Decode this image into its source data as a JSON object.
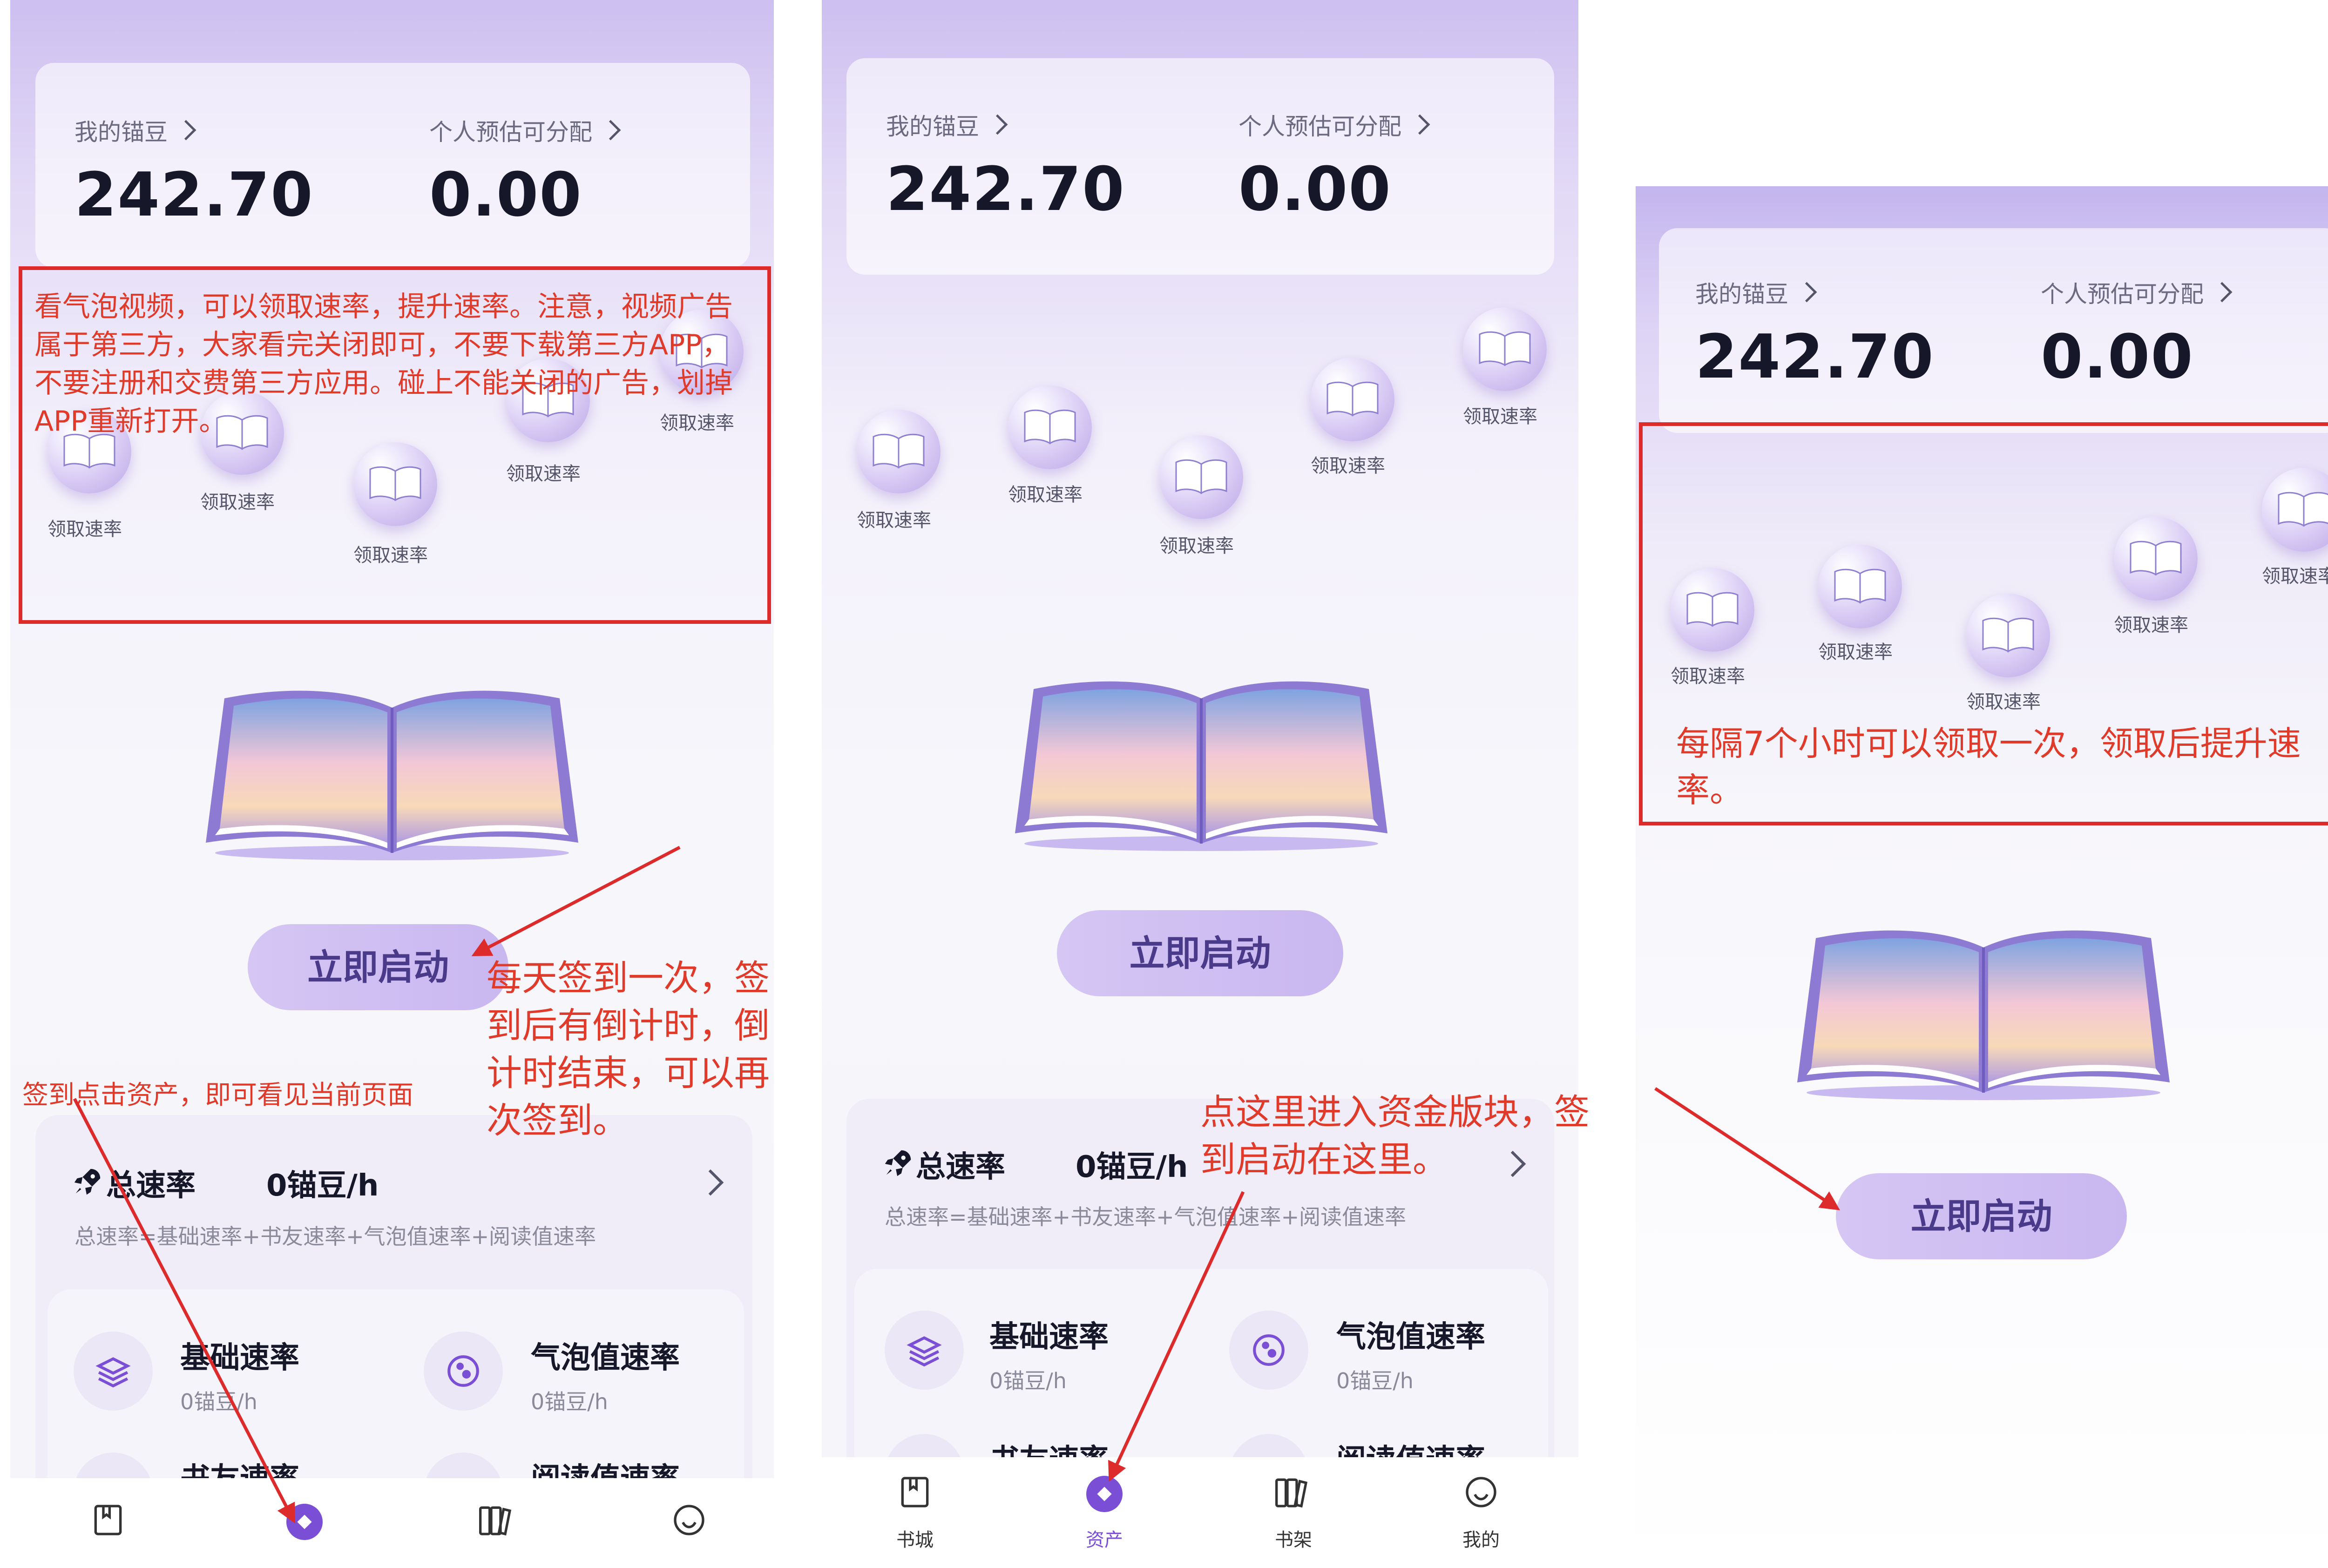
{
  "screens": [
    {
      "cards": {
        "beans_label": "我的锚豆",
        "beans_value": "242.70",
        "share_label": "个人预估可分配",
        "share_value": "0.00"
      },
      "bubble_label": "领取速率",
      "start_button": "立即启动",
      "rates": {
        "total_title": "总速率",
        "total_value": "0锚豆/h",
        "formula": "总速率=基础速率+书友速率+气泡值速率+阅读值速率",
        "items": [
          {
            "title": "基础速率",
            "value": "0锚豆/h",
            "icon": "layers-icon"
          },
          {
            "title": "气泡值速率",
            "value": "0锚豆/h",
            "icon": "bubble-icon"
          },
          {
            "title": "书友速率",
            "icon": "friends-icon"
          },
          {
            "title": "阅读值速率",
            "icon": "reading-icon"
          }
        ]
      },
      "nav": [
        {
          "label": "书城",
          "icon": "book-store-icon"
        },
        {
          "label": "资产",
          "icon": "assets-icon"
        },
        {
          "label": "书架",
          "icon": "bookshelf-icon"
        },
        {
          "label": "我的",
          "icon": "profile-icon"
        }
      ]
    }
  ],
  "annotations": {
    "bubble_video_note": "看气泡视频，可以领取速率，提升速率。注意，视频广告属于第三方，大家看完关闭即可，不要下载第三方APP，不要注册和交费第三方应用。碰上不能关闭的广告，划掉APP重新打开。",
    "daily_signin_note": "每天签到一次，签到后有倒计时，倒计时结束，可以再次签到。",
    "assets_page_note": "签到点击资产，即可看见当前页面",
    "funds_section_note": "点这里进入资金版块，签到启动在这里。",
    "seven_hour_note": "每隔7个小时可以领取一次，领取后提升速率。"
  },
  "colors": {
    "annotation_red": "#dd2b2b",
    "accent_purple": "#7a4fd6",
    "button_bg": "#cfc0f2"
  }
}
